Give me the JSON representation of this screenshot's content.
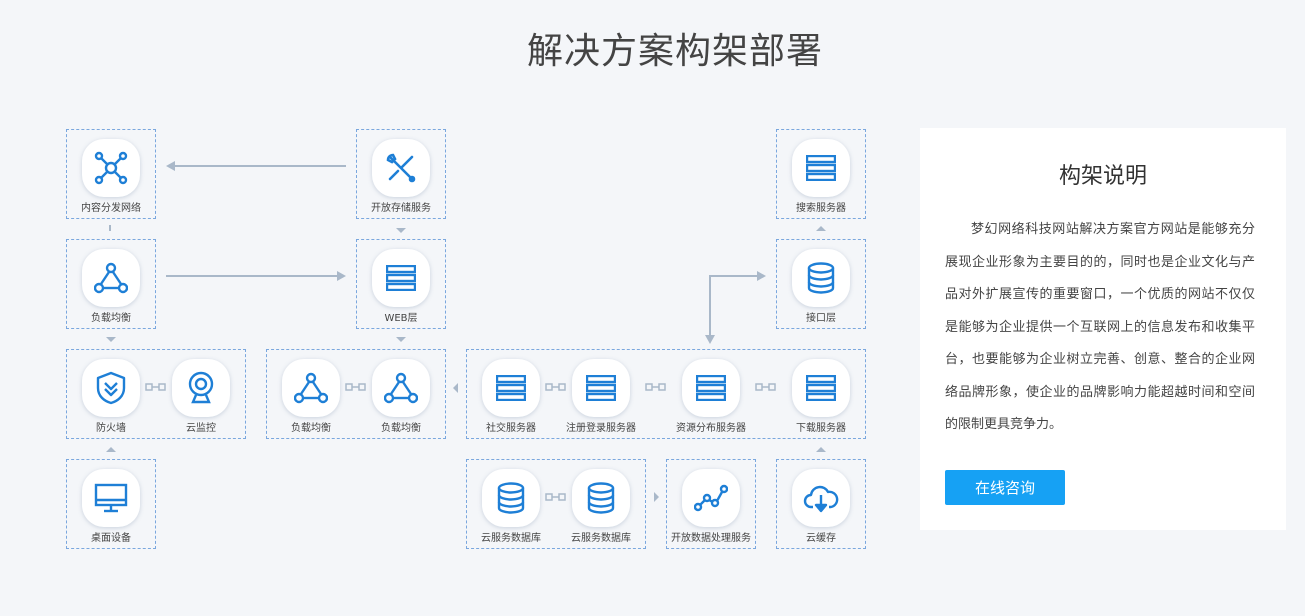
{
  "title": "解决方案构架部署",
  "colors": {
    "accent": "#1e7fd6",
    "button": "#16a1f4",
    "dashed": "#7aa7de",
    "arrow": "#a9b8c9"
  },
  "nodes": [
    {
      "id": "cdn",
      "label": "内容分发网络",
      "icon": "network-hub-icon"
    },
    {
      "id": "storage",
      "label": "开放存储服务",
      "icon": "wrench-screwdriver-icon"
    },
    {
      "id": "search",
      "label": "搜索服务器",
      "icon": "server-icon"
    },
    {
      "id": "lb1",
      "label": "负载均衡",
      "icon": "load-balance-icon"
    },
    {
      "id": "web",
      "label": "WEB层",
      "icon": "server-icon"
    },
    {
      "id": "api",
      "label": "接口层",
      "icon": "database-icon"
    },
    {
      "id": "firewall",
      "label": "防火墙",
      "icon": "shield-icon"
    },
    {
      "id": "monitor",
      "label": "云监控",
      "icon": "webcam-icon"
    },
    {
      "id": "lb2",
      "label": "负载均衡",
      "icon": "load-balance-icon"
    },
    {
      "id": "lb3",
      "label": "负载均衡",
      "icon": "load-balance-icon"
    },
    {
      "id": "social",
      "label": "社交服务器",
      "icon": "server-icon"
    },
    {
      "id": "login",
      "label": "注册登录服务器",
      "icon": "server-icon"
    },
    {
      "id": "resource",
      "label": "资源分布服务器",
      "icon": "server-icon"
    },
    {
      "id": "download",
      "label": "下载服务器",
      "icon": "server-icon"
    },
    {
      "id": "desktop",
      "label": "桌面设备",
      "icon": "monitor-icon"
    },
    {
      "id": "db1",
      "label": "云服务数据库",
      "icon": "database-icon"
    },
    {
      "id": "db2",
      "label": "云服务数据库",
      "icon": "database-icon"
    },
    {
      "id": "dataproc",
      "label": "开放数据处理服务",
      "icon": "line-chart-icon"
    },
    {
      "id": "cache",
      "label": "云缓存",
      "icon": "cloud-download-icon"
    }
  ],
  "sidebar": {
    "title": "构架说明",
    "text": "梦幻网络科技网站解决方案官方网站是能够充分展现企业形象为主要目的的，同时也是企业文化与产品对外扩展宣传的重要窗口，一个优质的网站不仅仅是能够为企业提供一个互联网上的信息发布和收集平台，也要能够为企业树立完善、创意、整合的企业网络品牌形象，使企业的品牌影响力能超越时间和空间的限制更具竞争力。",
    "button_label": "在线咨询"
  }
}
